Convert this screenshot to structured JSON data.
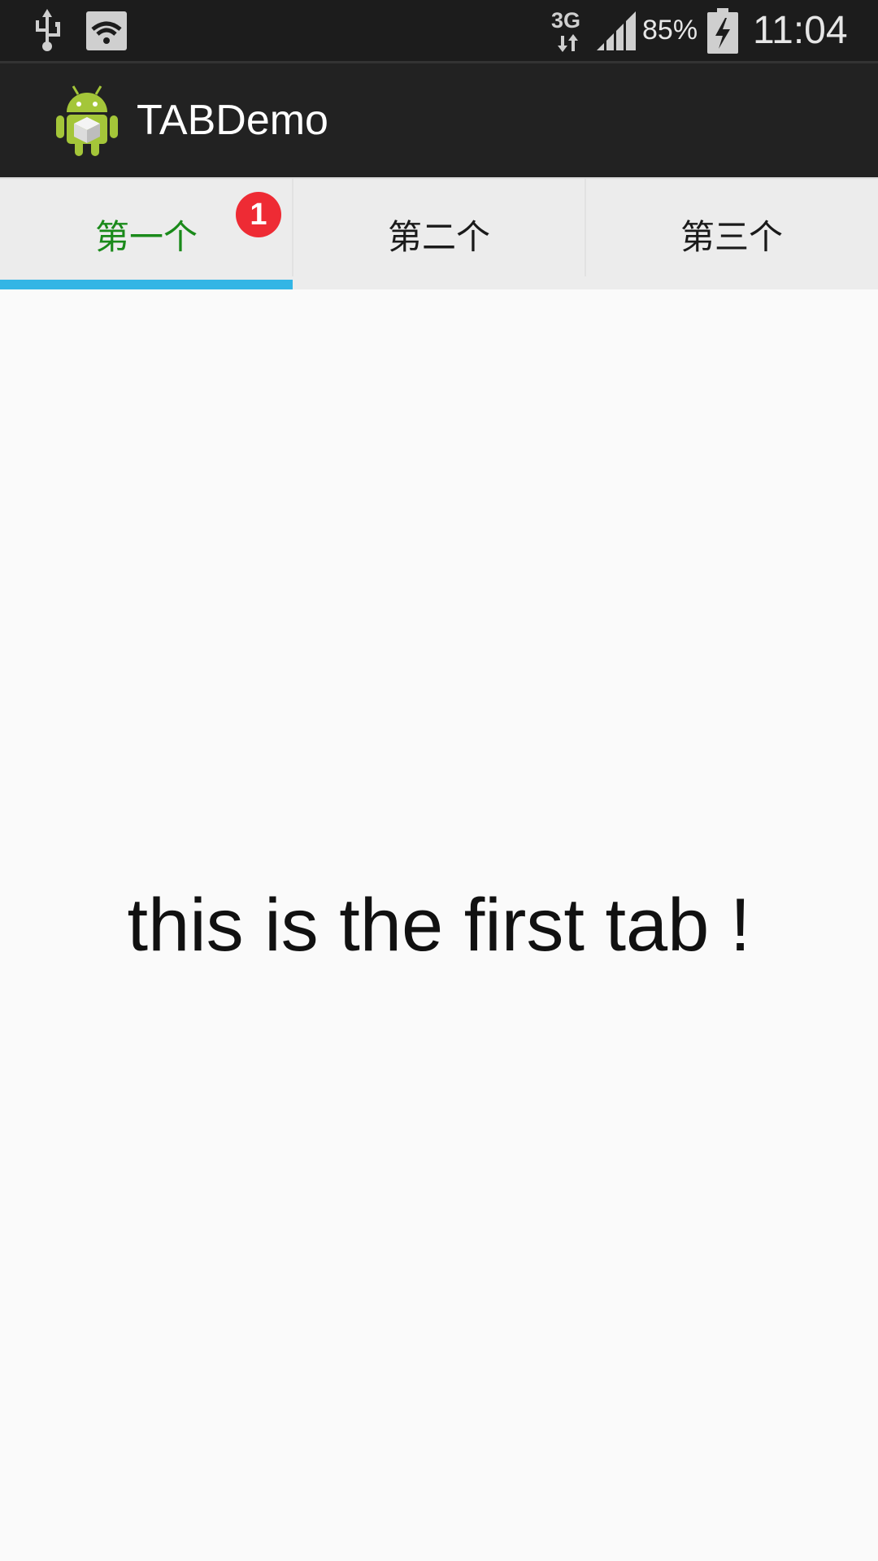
{
  "status_bar": {
    "network_type": "3G",
    "battery_percent": "85%",
    "time": "11:04",
    "icons": [
      "usb-icon",
      "wifi-icon",
      "network-3g-icon",
      "signal-icon",
      "battery-charging-icon"
    ]
  },
  "action_bar": {
    "title": "TABDemo",
    "icon": "android-icon"
  },
  "tabs": [
    {
      "label": "第一个",
      "selected": true,
      "badge": "1"
    },
    {
      "label": "第二个",
      "selected": false
    },
    {
      "label": "第三个",
      "selected": false
    }
  ],
  "content": {
    "text": "this is the first tab !"
  },
  "colors": {
    "status_bar_bg": "#1c1c1c",
    "action_bar_bg": "#222222",
    "tab_bg": "#ececec",
    "selected_tab_text": "#1a8a1a",
    "indicator": "#33b5e5",
    "badge": "#ee2b34"
  }
}
